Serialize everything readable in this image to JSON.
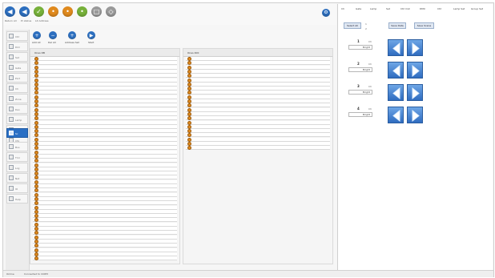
{
  "window": {
    "frame_color": "#cfcfcf"
  },
  "top_toolbar": {
    "buttons": [
      {
        "name": "back",
        "icon": "left-arrow-icon",
        "color": "#2d6fbf"
      },
      {
        "name": "forward",
        "icon": "left-arrow-icon",
        "color": "#2d6fbf"
      },
      {
        "name": "action-3",
        "icon": "check-icon",
        "color": "#77b13a"
      },
      {
        "name": "action-4",
        "icon": "circle-icon",
        "color": "#e08a1e"
      },
      {
        "name": "action-5",
        "icon": "circle-icon",
        "color": "#e08a1e"
      },
      {
        "name": "action-6",
        "icon": "circle-icon",
        "color": "#77b13a"
      },
      {
        "name": "action-7",
        "icon": "document-icon",
        "color": "#9a9a9a"
      },
      {
        "name": "action-8",
        "icon": "lock-icon",
        "color": "#9a9a9a"
      }
    ],
    "labels": [
      "Return All",
      "Pr status",
      "Lit Address"
    ],
    "settings_icon": "gear-icon"
  },
  "sidebar": {
    "items": [
      {
        "label": "Ctrl"
      },
      {
        "label": "Dim"
      },
      {
        "label": "Set"
      },
      {
        "label": "Gate"
      },
      {
        "label": "Port"
      },
      {
        "label": "Ch"
      },
      {
        "label": "Zone"
      },
      {
        "label": "Dev"
      },
      {
        "label": "Lamp"
      },
      {
        "label": "Grp"
      },
      {
        "label": "Cfg"
      },
      {
        "label": "Sc",
        "active": true
      },
      {
        "label": "Bus"
      },
      {
        "label": "Tmr"
      },
      {
        "label": "Log"
      },
      {
        "label": "Net"
      },
      {
        "label": "IO"
      },
      {
        "label": "Help"
      }
    ]
  },
  "secondary_toolbar": {
    "buttons": [
      {
        "label": "Add All",
        "icon": "plus-icon"
      },
      {
        "label": "Del All",
        "icon": "minus-icon"
      },
      {
        "label": "Address Set",
        "icon": "plus-icon"
      },
      {
        "label": "Start",
        "icon": "play-icon"
      }
    ]
  },
  "panels": {
    "left": {
      "header": "Ones DB",
      "row_count": 48
    },
    "right": {
      "header": "Ones 400",
      "row_count": 22
    }
  },
  "right_pane": {
    "menu": [
      "Ch",
      "Gate",
      "Lamp",
      "Set",
      "Ctrl Out",
      "DMX",
      "Ctrl",
      "Lamp Set",
      "Group Set"
    ],
    "top_buttons": [
      "Select All",
      "Save Data",
      "Save Scene"
    ],
    "small_values": [
      "1",
      "2"
    ],
    "channels": [
      {
        "number": "1",
        "unit": "Ch",
        "value": "Bright"
      },
      {
        "number": "2",
        "unit": "Ch",
        "value": "Bright"
      },
      {
        "number": "3",
        "unit": "Ch",
        "value": "Bright"
      },
      {
        "number": "4",
        "unit": "Ch",
        "value": "Bright"
      }
    ],
    "arrow_icons": [
      "left-arrow-icon",
      "right-arrow-icon"
    ]
  },
  "status_bar": {
    "left": "Online",
    "right": "Connected to COM3"
  }
}
